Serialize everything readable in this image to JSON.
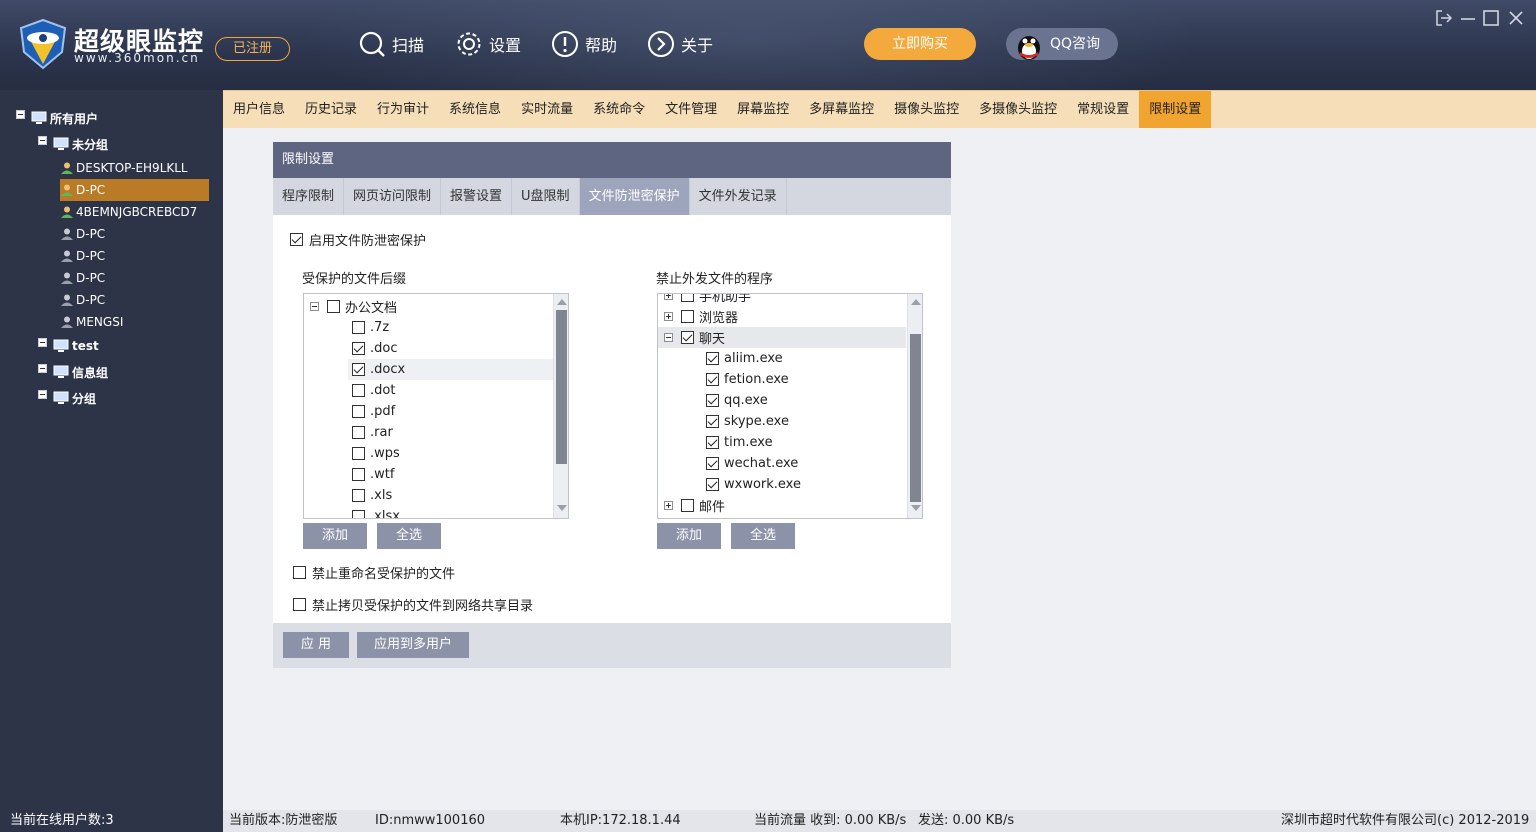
{
  "header": {
    "brand_name": "超级眼监控",
    "brand_url": "www.360mon.cn",
    "registered_label": "已注册",
    "nav": [
      {
        "label": "扫描",
        "icon": "search-icon"
      },
      {
        "label": "设置",
        "icon": "gear-icon"
      },
      {
        "label": "帮助",
        "icon": "help-icon"
      },
      {
        "label": "关于",
        "icon": "about-icon"
      }
    ],
    "buy_label": "立即购买",
    "qq_label": "QQ咨询"
  },
  "sidebar": {
    "root": "所有用户",
    "groups": [
      {
        "label": "未分组"
      },
      {
        "label": "test"
      },
      {
        "label": "信息组"
      },
      {
        "label": "分组"
      }
    ],
    "users": [
      {
        "label": "DESKTOP-EH9LKLL",
        "online": true
      },
      {
        "label": "D-PC",
        "online": true,
        "selected": true
      },
      {
        "label": "4BEMNJGBCREBCD7",
        "online": true
      },
      {
        "label": "D-PC",
        "online": false
      },
      {
        "label": "D-PC",
        "online": false
      },
      {
        "label": "D-PC",
        "online": false
      },
      {
        "label": "D-PC",
        "online": false
      },
      {
        "label": "MENGSI",
        "online": false
      }
    ]
  },
  "tabs": [
    {
      "label": "用户信息"
    },
    {
      "label": "历史记录"
    },
    {
      "label": "行为审计"
    },
    {
      "label": "系统信息"
    },
    {
      "label": "实时流量"
    },
    {
      "label": "系统命令"
    },
    {
      "label": "文件管理"
    },
    {
      "label": "屏幕监控"
    },
    {
      "label": "多屏幕监控"
    },
    {
      "label": "摄像头监控"
    },
    {
      "label": "多摄像头监控"
    },
    {
      "label": "常规设置"
    },
    {
      "label": "限制设置",
      "active": true
    }
  ],
  "panel": {
    "title": "限制设置",
    "subtabs": [
      {
        "label": "程序限制"
      },
      {
        "label": "网页访问限制"
      },
      {
        "label": "报警设置"
      },
      {
        "label": "U盘限制"
      },
      {
        "label": "文件防泄密保护",
        "active": true
      },
      {
        "label": "文件外发记录"
      }
    ],
    "enable_label": "启用文件防泄密保护",
    "enable_checked": true,
    "ext_title": "受保护的文件后缀",
    "ext_group": "办公文档",
    "ext_items": [
      {
        "label": ".7z",
        "checked": false
      },
      {
        "label": ".doc",
        "checked": true
      },
      {
        "label": ".docx",
        "checked": true
      },
      {
        "label": ".dot",
        "checked": false
      },
      {
        "label": ".pdf",
        "checked": false
      },
      {
        "label": ".rar",
        "checked": false
      },
      {
        "label": ".wps",
        "checked": false
      },
      {
        "label": ".wtf",
        "checked": false
      },
      {
        "label": ".xls",
        "checked": false
      },
      {
        "label": ".xlsx",
        "checked": false
      }
    ],
    "prog_title": "禁止外发文件的程序",
    "prog_partial_top": "手机助手",
    "prog_browser": "浏览器",
    "prog_chat": "聊天",
    "prog_items": [
      {
        "label": "aliim.exe",
        "checked": true
      },
      {
        "label": "fetion.exe",
        "checked": true
      },
      {
        "label": "qq.exe",
        "checked": true
      },
      {
        "label": "skype.exe",
        "checked": true
      },
      {
        "label": "tim.exe",
        "checked": true
      },
      {
        "label": "wechat.exe",
        "checked": true
      },
      {
        "label": "wxwork.exe",
        "checked": true
      }
    ],
    "prog_mail": "邮件",
    "add_label": "添加",
    "select_all_label": "全选",
    "opt_rename": "禁止重命名受保护的文件",
    "opt_copy_share": "禁止拷贝受保护的文件到网络共享目录",
    "apply_label": "应 用",
    "apply_multi_label": "应用到多用户"
  },
  "status": {
    "online_users": "当前在线用户数:3",
    "version": "当前版本:防泄密版",
    "id": "ID:nmww100160",
    "ip": "本机IP:172.18.1.44",
    "traffic_recv": "当前流量 收到: 0.00 KB/s",
    "traffic_send": "发送: 0.00 KB/s",
    "copyright": "深圳市超时代软件有限公司(c) 2012-2019"
  },
  "colors": {
    "header_bg": "#2c354d",
    "sidebar_bg": "#2d3448",
    "tab_bar_bg": "#f5deb8",
    "tab_active": "#f2a431",
    "panel_title_bg": "#5d6581",
    "button_gray": "#8c93a8",
    "buy_orange": "#f4a93c",
    "selected_row": "#b97b25"
  }
}
